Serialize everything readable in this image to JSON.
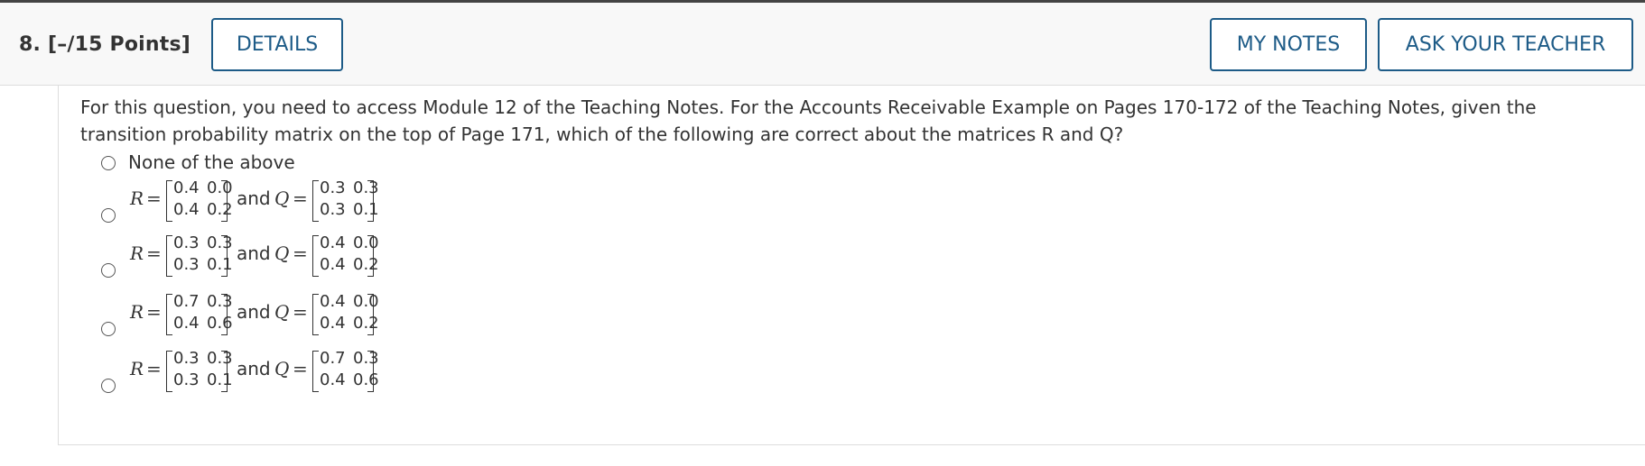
{
  "question": {
    "number_label": "8.",
    "points_label": "[–/15 Points]",
    "details_button": "DETAILS",
    "my_notes_button": "MY NOTES",
    "ask_teacher_button": "ASK YOUR TEACHER",
    "prompt": "For this question, you need to access Module 12 of the Teaching Notes. For the Accounts Receivable Example on Pages 170-172 of the Teaching Notes, given the transition probability matrix on the top of Page 171, which of the following are correct about the matrices R and Q?"
  },
  "options": {
    "none_label": "None of the above",
    "and_label": "and",
    "r_symbol": "R",
    "q_symbol": "Q",
    "equals": "=",
    "matrices": [
      {
        "R": [
          "0.4",
          "0.0",
          "0.4",
          "0.2"
        ],
        "Q": [
          "0.3",
          "0.3",
          "0.3",
          "0.1"
        ]
      },
      {
        "R": [
          "0.3",
          "0.3",
          "0.3",
          "0.1"
        ],
        "Q": [
          "0.4",
          "0.0",
          "0.4",
          "0.2"
        ]
      },
      {
        "R": [
          "0.7",
          "0.3",
          "0.4",
          "0.6"
        ],
        "Q": [
          "0.4",
          "0.0",
          "0.4",
          "0.2"
        ]
      },
      {
        "R": [
          "0.3",
          "0.3",
          "0.3",
          "0.1"
        ],
        "Q": [
          "0.7",
          "0.3",
          "0.4",
          "0.6"
        ]
      }
    ]
  },
  "colors": {
    "accent": "#1d5b87",
    "header_bg": "#f8f8f8",
    "text": "#333333"
  }
}
